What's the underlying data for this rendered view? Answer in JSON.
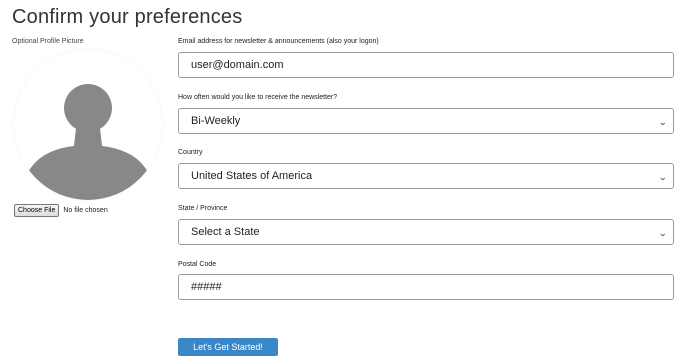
{
  "page": {
    "title": "Confirm your preferences"
  },
  "profile": {
    "label": "Optional Profile Picture",
    "choose_file_label": "Choose File",
    "file_status": "No file chosen"
  },
  "email": {
    "label": "Email address for newsletter & announcements (also your logon)",
    "value": "user@domain.com"
  },
  "frequency": {
    "label": "How often would you like to receive the newsletter?",
    "value": "Bi-Weekly"
  },
  "country": {
    "label": "Country",
    "value": "United States of America"
  },
  "state": {
    "label": "State / Province",
    "value": "Select a State"
  },
  "postal": {
    "label": "Postal Code",
    "value": "#####"
  },
  "submit": {
    "label": "Let's Get Started!"
  },
  "colors": {
    "accent": "#3a87c7",
    "avatar": "#888888"
  }
}
